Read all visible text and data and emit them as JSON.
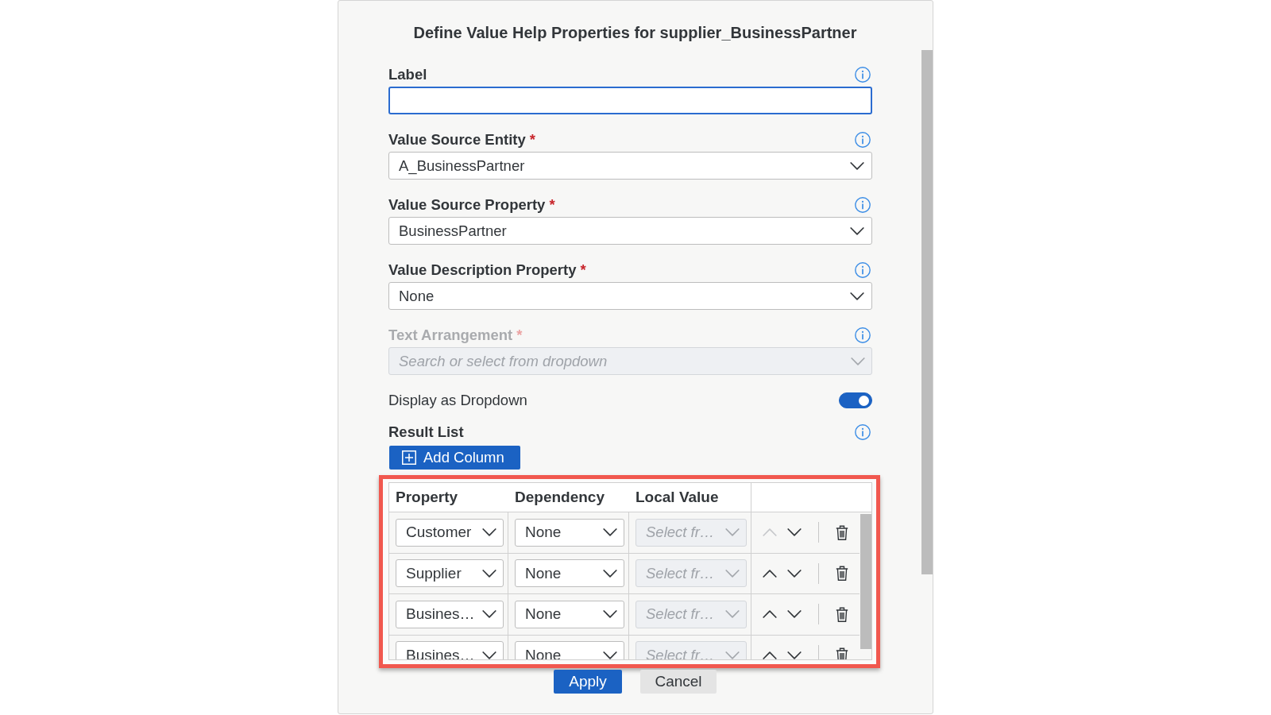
{
  "dialog": {
    "title": "Define Value Help Properties for supplier_BusinessPartner"
  },
  "fields": [
    {
      "kind": "input",
      "label": "Label",
      "focused": true,
      "disabled": false
    },
    {
      "kind": "dropdown",
      "label": "Value Source Entity",
      "required_mark": "*",
      "focused": false,
      "disabled": false,
      "value": "A_BusinessPartner"
    },
    {
      "kind": "dropdown",
      "label": "Value Source Property",
      "required_mark": "*",
      "focused": false,
      "disabled": false,
      "value": "BusinessPartner"
    },
    {
      "kind": "dropdown",
      "label": "Value Description Property",
      "required_mark": "*",
      "focused": false,
      "disabled": false,
      "value": "None"
    },
    {
      "kind": "dropdown",
      "label": "Text Arrangement",
      "required_mark": "*",
      "focused": false,
      "disabled": true,
      "placeholder": "Search or select from dropdown"
    }
  ],
  "toggle": {
    "label": "Display as Dropdown",
    "on": true
  },
  "result_list": {
    "label": "Result List",
    "add_button": "Add Column",
    "columns": [
      "Property",
      "Dependency",
      "Local Value"
    ],
    "rows": [
      {
        "property": "Customer",
        "dependency": "None",
        "local_value": {
          "placeholder": "Select fr…",
          "disabled": true
        },
        "up_disabled": true,
        "down_disabled": false
      },
      {
        "property": "Supplier",
        "dependency": "None",
        "local_value": {
          "placeholder": "Select fr…",
          "disabled": true
        },
        "up_disabled": false,
        "down_disabled": false
      },
      {
        "property": "Busines…",
        "dependency": "None",
        "local_value": {
          "placeholder": "Select fr…",
          "disabled": true
        },
        "up_disabled": false,
        "down_disabled": false
      },
      {
        "property": "Busines…",
        "dependency": "None",
        "local_value": {
          "placeholder": "Select fr…",
          "disabled": true
        },
        "up_disabled": false,
        "down_disabled": false
      }
    ]
  },
  "buttons": [
    {
      "label": "Apply",
      "kind": "primary"
    },
    {
      "label": "Cancel",
      "kind": "secondary"
    }
  ]
}
